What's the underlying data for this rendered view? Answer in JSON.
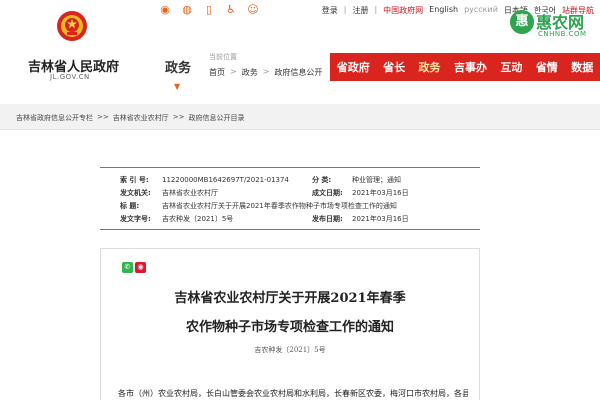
{
  "share_bar": {
    "icons": [
      "sina-weibo-icon",
      "wechat-icon",
      "mobile-icon",
      "accessibility-icon",
      "elder-care-icon"
    ]
  },
  "toplinks": {
    "login": "登录",
    "register": "注册",
    "cn_gov": "中国政府网",
    "english": "English",
    "russian": "русский",
    "japanese": "日本語",
    "korean": "한국어",
    "guide": "站群导航"
  },
  "header": {
    "site_name": "吉林省人民政府",
    "site_url": "JL.GOV.CN",
    "section": "政务",
    "crumb_label": "当前位置",
    "crumbs": [
      "首页",
      "政务",
      "政府信息公开"
    ],
    "crumb_sep": ">"
  },
  "mainnav": [
    "省政府",
    "省长",
    "政务",
    "吉事办",
    "互动",
    "省情",
    "数据"
  ],
  "watermark": {
    "logo_char": "惠",
    "name": "惠农网",
    "url": "CNHNB.COM"
  },
  "path": [
    "吉林省政府信息公开专栏",
    ">>",
    "吉林省农业农村厅",
    ">>",
    "政府信息公开目录"
  ],
  "info": {
    "index_label": "索 引 号:",
    "index_value": "11220000MB1642697T/2021-01374",
    "category_label": "分    类:",
    "category_value": "种业管理；通知",
    "issuer_label": "发文机关:",
    "issuer_value": "吉林省农业农村厅",
    "created_label": "成文日期:",
    "created_value": "2021年03月16日",
    "title_label": "标    题:",
    "title_value": "吉林省农业农村厅关于开展2021年春季农作物种子市场专项检查工作的通知",
    "docno_label": "发文字号:",
    "docno_value": "吉农种发〔2021〕5号",
    "published_label": "发布日期:",
    "published_value": "2021年03月16日"
  },
  "doc": {
    "title_line1": "吉林省农业农村厅关于开展2021年春季",
    "title_line2": "农作物种子市场专项检查工作的通知",
    "doc_number": "吉农种发〔2021〕5号",
    "body_start": "各市（州）农业农村局，长白山管委会农业农村局和水利局，长春新区农委，梅河口市农村局，各县"
  }
}
